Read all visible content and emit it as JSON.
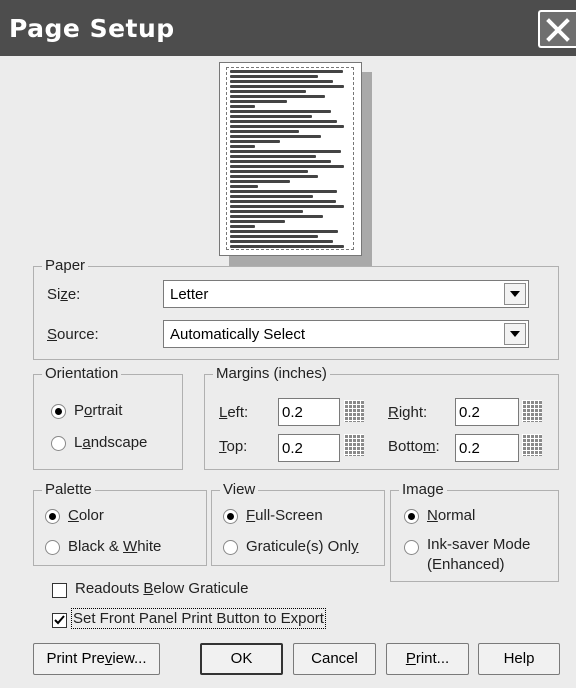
{
  "window": {
    "title": "Page Setup",
    "close_icon": "close-icon"
  },
  "paper": {
    "group_label": "Paper",
    "size_label_pre": "Si",
    "size_label_u": "z",
    "size_label_post": "e:",
    "size_value": "Letter",
    "source_label_pre": "",
    "source_label_u": "S",
    "source_label_post": "ource:",
    "source_value": "Automatically Select"
  },
  "orientation": {
    "group_label": "Orientation",
    "portrait_pre": "P",
    "portrait_u": "o",
    "portrait_post": "rtrait",
    "landscape_pre": "L",
    "landscape_u": "a",
    "landscape_post": "ndscape",
    "selected": "portrait"
  },
  "margins": {
    "group_label": "Margins (inches)",
    "left_u": "L",
    "left_post": "eft:",
    "left_value": "0.2",
    "right_u": "R",
    "right_post": "ight:",
    "right_value": "0.2",
    "top_u": "T",
    "top_post": "op:",
    "top_value": "0.2",
    "bottom_pre": "Botto",
    "bottom_u": "m",
    "bottom_post": ":",
    "bottom_value": "0.2"
  },
  "palette": {
    "group_label": "Palette",
    "color_u": "C",
    "color_post": "olor",
    "bw_pre": "Black & ",
    "bw_u": "W",
    "bw_post": "hite",
    "selected": "color"
  },
  "view": {
    "group_label": "View",
    "full_u": "F",
    "full_post": "ull-Screen",
    "grat_pre": "Graticule(s) Onl",
    "grat_u": "y",
    "grat_post": "",
    "selected": "full-screen"
  },
  "image": {
    "group_label": "Image",
    "normal_u": "N",
    "normal_post": "ormal",
    "inksaver_line1": "Ink-saver Mode",
    "inksaver_line2": "(Enhanced)",
    "selected": "normal"
  },
  "options": {
    "readouts_pre": "Readouts ",
    "readouts_u": "B",
    "readouts_post": "elow Graticule",
    "readouts_checked": false,
    "export_label": "Set Front Panel Print Button to Export",
    "export_checked": true
  },
  "buttons": {
    "preview_pre": "Print Pre",
    "preview_u": "v",
    "preview_post": "iew...",
    "ok": "OK",
    "cancel": "Cancel",
    "print_u": "P",
    "print_post": "rint...",
    "help": "Help"
  }
}
